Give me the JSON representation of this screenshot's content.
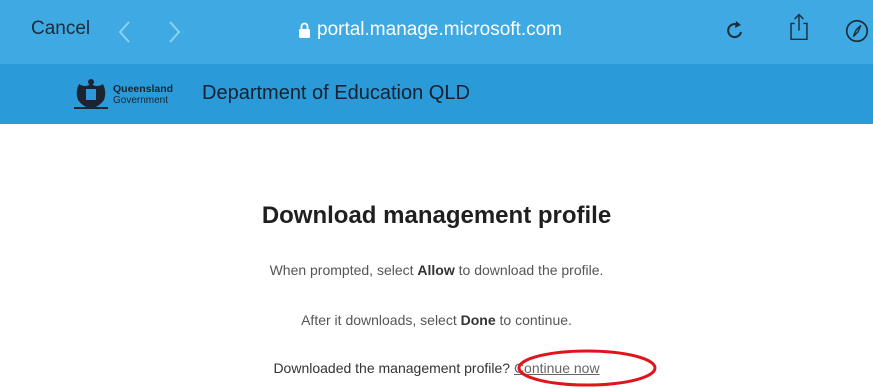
{
  "browser": {
    "cancel_label": "Cancel",
    "address": "portal.manage.microsoft.com",
    "bar_color": "#3ea9e2"
  },
  "icons": {
    "back": "chevron-left-icon",
    "forward": "chevron-right-icon",
    "lock": "lock-icon",
    "reload": "reload-icon",
    "share": "share-icon",
    "compass": "compass-icon"
  },
  "header": {
    "logo_line1": "Queensland",
    "logo_line2": "Government",
    "title": "Department of Education QLD",
    "header_color": "#2a9bd8"
  },
  "main": {
    "heading": "Download management profile",
    "line1_pre": "When prompted, select ",
    "line1_bold": "Allow",
    "line1_post": " to download the profile.",
    "line2_pre": "After it downloads, select ",
    "line2_bold": "Done",
    "line2_post": " to continue.",
    "line3_text": "Downloaded the management profile? ",
    "continue_link": "Continue now",
    "annotation_color": "#e0141b"
  }
}
